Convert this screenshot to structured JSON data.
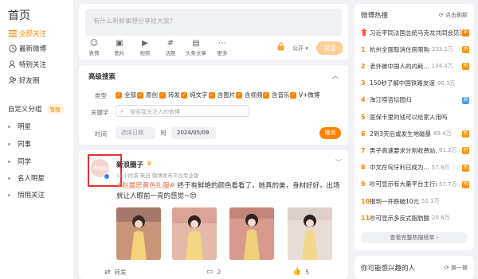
{
  "nav": {
    "home": "首页",
    "items": [
      {
        "label": "全部关注",
        "icon": "list-icon"
      },
      {
        "label": "最新微博",
        "icon": "clock-icon"
      },
      {
        "label": "特别关注",
        "icon": "user-star-icon"
      },
      {
        "label": "好友圈",
        "icon": "friends-icon"
      }
    ],
    "group_title": "自定义分组",
    "manage": "管理",
    "groups": [
      "明星",
      "同事",
      "同学",
      "名人明星",
      "悄悄关注"
    ]
  },
  "composer": {
    "placeholder": "有什么新鲜事想分享给大家?",
    "tools": [
      {
        "label": "表情",
        "glyph": "☺",
        "icon": "emoji-icon"
      },
      {
        "label": "图片",
        "glyph": "▣",
        "icon": "image-icon"
      },
      {
        "label": "视频",
        "glyph": "▶",
        "icon": "video-icon"
      },
      {
        "label": "话题",
        "glyph": "#",
        "icon": "topic-icon"
      },
      {
        "label": "头条文章",
        "glyph": "▤",
        "icon": "article-icon"
      },
      {
        "label": "更多",
        "glyph": "⋯",
        "icon": "more-icon"
      }
    ],
    "visibility": "公开 ▾",
    "send": "发送"
  },
  "advanced": {
    "title": "高级搜索",
    "type_label": "类型",
    "types": [
      "全部",
      "原创",
      "转发",
      "纯文字",
      "含图片",
      "含视频",
      "含音乐",
      "V+微博"
    ],
    "keyword_label": "关键字",
    "keyword_placeholder": "搜索我关注人的微博",
    "time_label": "时间",
    "start_placeholder": "选择日期",
    "to": "到",
    "end_date": "2024/05/09",
    "search": "搜索"
  },
  "post": {
    "avatar_text": "新浪圈子",
    "user": "新浪圈子",
    "meta": "16小时前 来自 微博发布平台专业版",
    "tag": "#赵露思黄色礼服#",
    "text": " 终于有鲜艳的颜色看看了，她真的美，身材好好，出场就让人眼前一亮的感觉~",
    "emoji": "😍",
    "photo_colors": [
      "#c99579",
      "#e6b8aa",
      "#d89a8c",
      "#e8ddd6"
    ],
    "actions": {
      "repost": "转发",
      "comment": "2",
      "like": "5"
    }
  },
  "hot": {
    "title": "微博热搜",
    "refresh": "点击刷新",
    "items": [
      {
        "rank": "",
        "text": "习近平同法国总统马克龙共同会见法国友好...",
        "count": "",
        "badge": "新",
        "badge_color": "#ff8200",
        "top": true
      },
      {
        "rank": "1",
        "text": "杭州全面取消住房限购",
        "count": "233.1万",
        "badge": "热",
        "badge_color": "#ff9406"
      },
      {
        "rank": "2",
        "text": "老外被中国人的内耗...",
        "count": "134.4万",
        "badge": "热",
        "badge_color": "#ff9406"
      },
      {
        "rank": "3",
        "text": "150秒了解中国铁路友谊",
        "count": "90.3万",
        "badge": "",
        "badge_color": ""
      },
      {
        "rank": "4",
        "text": "淘汀唠咨坛园归",
        "count": "",
        "badge": "商",
        "badge_color": "#4c9ee8"
      },
      {
        "rank": "5",
        "text": "医保卡里的钱可以给家人用吗",
        "count": "",
        "badge": "",
        "badge_color": ""
      },
      {
        "rank": "6",
        "text": "2到3天后或发生地磁暴",
        "count": "69.4万",
        "badge": "热",
        "badge_color": "#ff9406"
      },
      {
        "rank": "7",
        "text": "男子高速要求分割收费站...",
        "count": "61.2万",
        "badge": "热",
        "badge_color": "#ff9406"
      },
      {
        "rank": "8",
        "text": "中文在匈牙利已成为...",
        "count": "57.9万",
        "badge": "热",
        "badge_color": "#ff9406"
      },
      {
        "rank": "9",
        "text": "吵可显示有大量平台主行动",
        "count": "57.7万",
        "badge": "热",
        "badge_color": "#ff9406"
      },
      {
        "rank": "10",
        "text": "报到一开跌破10元",
        "count": "52.1万",
        "badge": "",
        "badge_color": ""
      },
      {
        "rank": "11",
        "text": "吵可显示多反式脂肪酸",
        "count": "20.6万",
        "badge": "",
        "badge_color": ""
      }
    ],
    "more": "查看完整热搜榜单 ›"
  },
  "recommend": {
    "title": "你可能感兴趣的人",
    "change": "换一换"
  }
}
